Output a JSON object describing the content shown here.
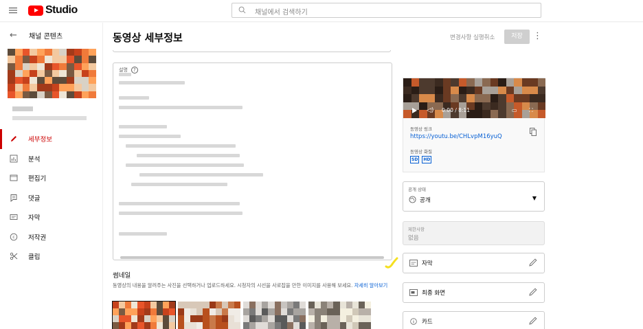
{
  "header": {
    "logo_text": "Studio",
    "search_placeholder": "채널에서 검색하기"
  },
  "sidebar": {
    "back_label": "채널 콘텐츠",
    "items": [
      {
        "label": "세부정보",
        "icon": "pencil-icon",
        "active": true
      },
      {
        "label": "분석",
        "icon": "analytics-icon",
        "active": false
      },
      {
        "label": "편집기",
        "icon": "editor-icon",
        "active": false
      },
      {
        "label": "댓글",
        "icon": "comments-icon",
        "active": false
      },
      {
        "label": "자막",
        "icon": "subtitles-icon",
        "active": false
      },
      {
        "label": "저작권",
        "icon": "copyright-icon",
        "active": false
      },
      {
        "label": "클립",
        "icon": "clip-icon",
        "active": false
      }
    ]
  },
  "main": {
    "title": "동영상 세부정보",
    "undo_label": "변경사항 실행취소",
    "save_label": "저장",
    "description": {
      "label": "설명"
    },
    "thumbnails": {
      "title": "썸네일",
      "description": "동영상의 내용을 알려주는 사진을 선택하거나 업로드하세요. 시청자의 시선을 사로잡을 만한 이미지를 사용해 보세요.",
      "learn_more": "자세히 알아보기"
    }
  },
  "right_panel": {
    "player": {
      "time": "0:00 / 8:11"
    },
    "video_link_label": "동영상 링크",
    "video_link": "https://youtu.be/CHLvpM16yuQ",
    "quality_label": "동영상 화질",
    "quality_badges": [
      "SD",
      "HD"
    ],
    "visibility": {
      "label": "공개 상태",
      "value": "공개"
    },
    "restrictions": {
      "label": "제한사항",
      "value": "없음"
    },
    "subtitles_label": "자막",
    "end_screen_label": "최종 화면",
    "cards_label": "카드"
  },
  "colors": {
    "accent_red": "#cc0000",
    "link_blue": "#065fd4",
    "highlight_yellow": "#f5e020"
  }
}
